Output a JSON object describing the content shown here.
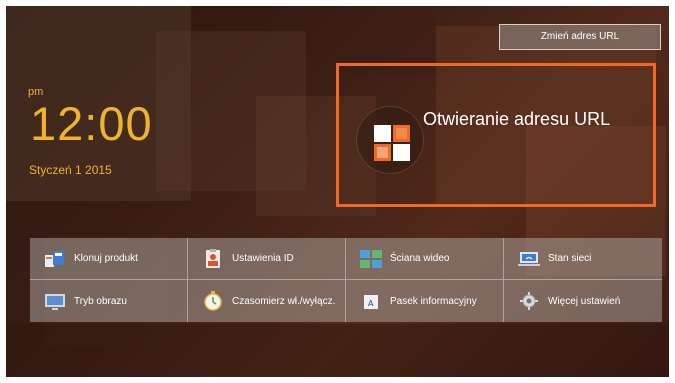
{
  "clock": {
    "ampm": "pm",
    "time": "12:00",
    "date": "Styczeń 1 2015"
  },
  "header": {
    "change_url_label": "Zmień adres URL"
  },
  "url_card": {
    "title": "Otwieranie adresu URL",
    "accent_color": "#ee6a26"
  },
  "menu": {
    "items": [
      {
        "label": "Klonuj produkt",
        "icon": "clone-product-icon"
      },
      {
        "label": "Ustawienia ID",
        "icon": "id-badge-icon"
      },
      {
        "label": "Ściana wideo",
        "icon": "video-wall-icon"
      },
      {
        "label": "Stan sieci",
        "icon": "network-status-icon"
      },
      {
        "label": "Tryb obrazu",
        "icon": "picture-mode-icon"
      },
      {
        "label": "Czasomierz wł./wyłącz.",
        "icon": "timer-icon"
      },
      {
        "label": "Pasek informacyjny",
        "icon": "ticker-icon"
      },
      {
        "label": "Więcej ustawień",
        "icon": "gear-icon"
      }
    ]
  },
  "colors": {
    "clock": "#f0b429",
    "background": "#3a1d14"
  }
}
